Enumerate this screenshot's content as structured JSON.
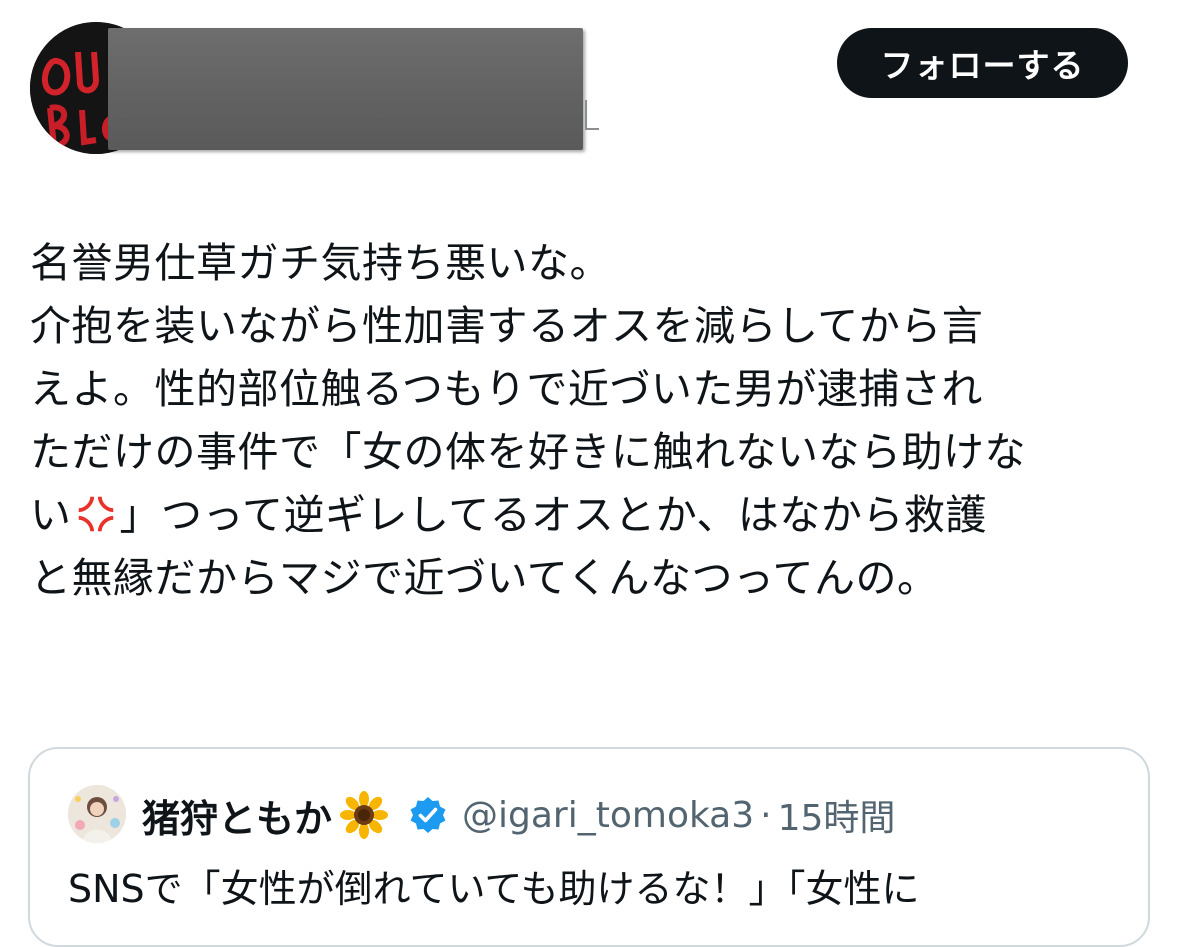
{
  "post": {
    "follow_label": "フォローする",
    "text_lines": [
      "名誉男仕草ガチ気持ち悪いな。",
      "介抱を装いながら性加害するオスを減らしてから言",
      "えよ。性的部位触るつもりで近づいた男が逮捕され",
      "ただけの事件で「女の体を好きに触れないなら助けな",
      "」つって逆ギレしてるオスとか、はなから救護",
      "と無縁だからマジで近づいてくんなつってんの。"
    ],
    "line5_prefix": "い",
    "emoji": "anger-symbol"
  },
  "quote": {
    "name": "猪狩ともか",
    "name_emoji": "sunflower",
    "verified": true,
    "handle": "@igari_tomoka3",
    "separator": "·",
    "time": "15時間",
    "text_partial": "SNSで「女性が倒れていても助けるな！」「女性に"
  },
  "colors": {
    "text": "#0f1419",
    "secondary": "#536471",
    "button_bg": "#0f1419",
    "verified_blue": "#1d9bf0",
    "card_border": "#cfd9de"
  }
}
